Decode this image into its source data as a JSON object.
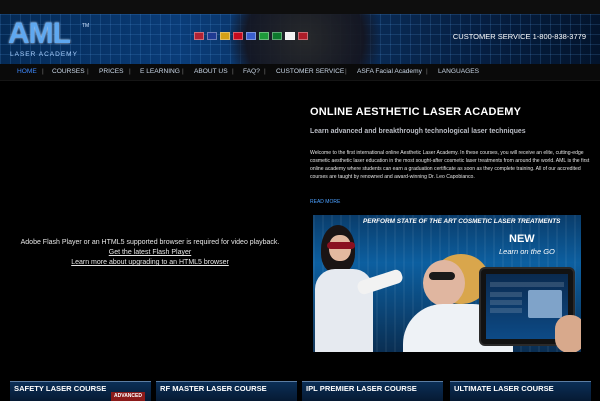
{
  "header": {
    "logo": {
      "text": "AML",
      "tm": "TM",
      "subtitle": "LASER ACADEMY"
    },
    "customer_service": "CUSTOMER SERVICE 1-800-838-3779",
    "flags": [
      {
        "name": "usa-flag",
        "color": "#b22234"
      },
      {
        "name": "uk-flag",
        "color": "#1f3a93"
      },
      {
        "name": "germany-flag",
        "color": "#d4a017"
      },
      {
        "name": "spain-flag",
        "color": "#c60b1e"
      },
      {
        "name": "russia-flag",
        "color": "#3a5fcd"
      },
      {
        "name": "italy-flag",
        "color": "#1d9a3a"
      },
      {
        "name": "portugal-flag",
        "color": "#0c7a2c"
      },
      {
        "name": "japan-flag",
        "color": "#f2f2f2"
      },
      {
        "name": "netherlands-flag",
        "color": "#ae1c28"
      }
    ]
  },
  "nav": {
    "items": [
      "HOME",
      "COURSES",
      "PRICES",
      "E LEARNING",
      "ABOUT US",
      "FAQ?",
      "CUSTOMER SERVICE",
      "ASFA Facial Academy",
      "LANGUAGES"
    ],
    "active_index": 0
  },
  "video": {
    "message": "Adobe Flash Player or an HTML5 supported browser is required for video playback.",
    "link1": "Get the latest Flash Player",
    "link2": "Learn more about upgrading to an HTML5 browser"
  },
  "main": {
    "title": "ONLINE AESTHETIC LASER ACADEMY",
    "subtitle": "Learn advanced and breakthrough technological laser techniques",
    "body": "Welcome to the first international online Aesthetic Laser Academy. In these courses, you will receive an elite, cutting-edge cosmetic aesthetic laser education in the most sought-after cosmetic laser treatments from around the world. AML is the first online academy where students can earn a graduation certificate as soon as they complete training. All of our accredited courses are taught by renowned and award-winning Dr. Leo Capobianco.",
    "read_more": "READ MORE"
  },
  "promo": {
    "headline": "PERFORM STATE OF THE ART COSMETIC LASER TREATMENTS",
    "new": "NEW",
    "tagline": "Learn on the GO"
  },
  "courses": [
    {
      "title": "SAFETY LASER COURSE",
      "badge": "ADVANCED"
    },
    {
      "title": "RF MASTER LASER COURSE",
      "badge": ""
    },
    {
      "title": "IPL PREMIER LASER COURSE",
      "badge": ""
    },
    {
      "title": "ULTIMATE LASER COURSE",
      "badge": ""
    }
  ],
  "colors": {
    "accent": "#3d89ff",
    "header_blue": "#0a3c78",
    "tile_blue": "#0b2f57"
  }
}
